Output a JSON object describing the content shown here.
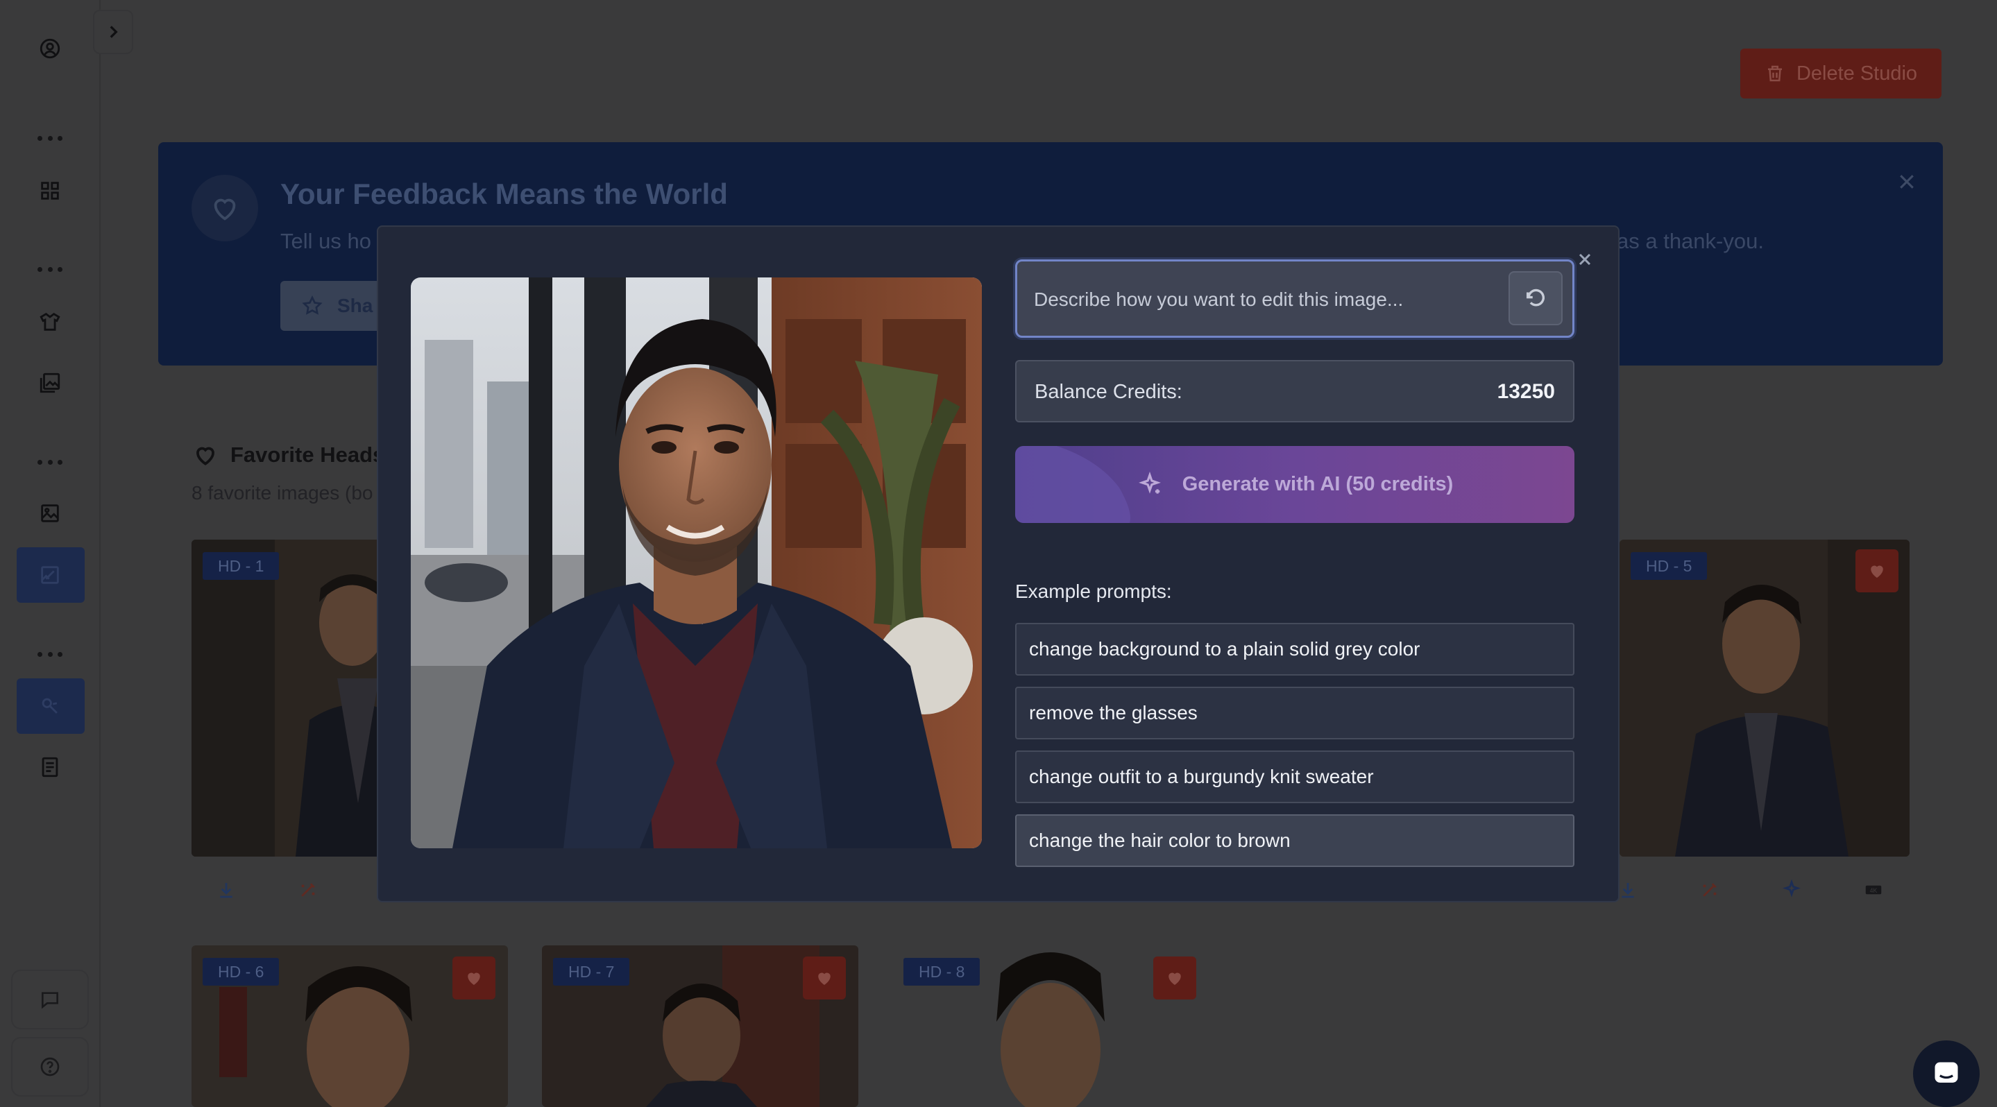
{
  "header": {
    "delete_label": "Delete Studio"
  },
  "banner": {
    "title": "Your Feedback Means the World",
    "subtitle_start": "Tell us ho",
    "subtitle_end": "as a thank-you.",
    "share_label": "Sha"
  },
  "favorites": {
    "title": "Favorite Heads",
    "count_text": "8 favorite images (bo",
    "cards": [
      {
        "badge": "HD - 1"
      },
      {
        "badge": "HD - 5"
      },
      {
        "badge": "HD - 6"
      },
      {
        "badge": "HD - 7"
      },
      {
        "badge": "HD - 8"
      }
    ]
  },
  "modal": {
    "prompt_placeholder": "Describe how you want to edit this image...",
    "balance_label": "Balance Credits:",
    "balance_value": "13250",
    "generate_label": "Generate with AI (50 credits)",
    "examples_label": "Example prompts:",
    "examples": [
      "change background to a plain solid grey color",
      "remove the glasses",
      "change outfit to a burgundy knit sweater",
      "change the hair color to brown"
    ]
  },
  "icons": {
    "sidebar": [
      "user-circle-icon",
      "grid-icon",
      "shirt-icon",
      "gallery-icon",
      "image-icon",
      "image-edit-icon",
      "palette-icon",
      "document-icon",
      "chat-icon",
      "help-icon"
    ],
    "card_actions": [
      "download-icon",
      "magic-wand-icon",
      "sparkle-icon",
      "4k-icon"
    ]
  },
  "colors": {
    "accent_blue": "#7285c8",
    "generate_gradient_start": "#4f3f8c",
    "generate_gradient_end": "#7c4791",
    "danger_dim": "#5f1d17"
  }
}
